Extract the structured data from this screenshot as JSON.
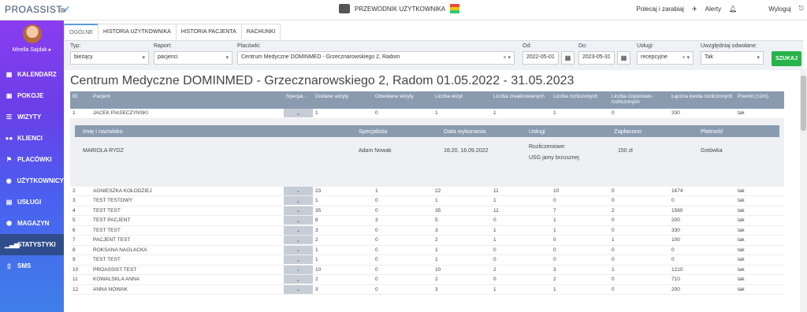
{
  "app": {
    "logo": "PROASSIST",
    "guide": "PRZEWODNIK UŻYTKOWNIKA",
    "recommend": "Polecaj i zarabiaj",
    "alerts": "Alerty",
    "logout": "Wyloguj"
  },
  "user": {
    "name": "Mirella Sajdak ▸"
  },
  "nav": [
    "KALENDARZ",
    "POKOJE",
    "WIZYTY",
    "KLIENCI",
    "PLACÓWKI",
    "UŻYTKOWNICY",
    "USŁUGI",
    "MAGAZYN",
    "STATYSTYKI",
    "SMS"
  ],
  "tabs": [
    "OGÓLNE",
    "HISTORIA UŻYTKOWNIKA",
    "HISTORIA PACJENTA",
    "RACHUNKI"
  ],
  "filters": {
    "type_label": "Typ:",
    "type_value": "bieżący",
    "report_label": "Raport:",
    "report_value": "pacjenci",
    "places_label": "Placówki:",
    "places_value": "Centrum Medyczne DOMINMED - Grzecznarowskiego 2, Radom",
    "from_label": "Od:",
    "from_value": "2022-05-01",
    "to_label": "Do:",
    "to_value": "2023-05-31",
    "services_label": "Usługi:",
    "services_value": "recepcyjne",
    "cancelled_label": "Uwzględniaj odwołane:",
    "cancelled_value": "Tak",
    "search_button": "SZUKAJ"
  },
  "title": "Centrum Medyczne DOMINMED - Grzecznarowskiego 2, Radom 01.05.2022 - 31.05.2023",
  "columns": [
    "ID",
    "Pacjent",
    "Specjal...",
    "Dodane wizyty",
    "Odwołane wizyty",
    "Liczba wizyt",
    "Liczba zrealizowanych",
    "Liczba rozliczonych",
    "Liczba częściowo-rozliczonych",
    "Łączna kwota rozliczonych",
    "Powrót (12m)"
  ],
  "first_row": [
    "1",
    "JACEK PIASECZYŃSKI",
    "1",
    "0",
    "1",
    "1",
    "1",
    "0",
    "330",
    "tak"
  ],
  "detail": {
    "headers": [
      "Imię i nazwisko",
      "Specjalista",
      "Data wykonania",
      "Usługi",
      "Zapłacono",
      "Płatność"
    ],
    "name": "MARIOLA RYDZ",
    "specialist": "Adam Nowak",
    "date": "16:20, 16.09.2022",
    "service_type": "Rozliczeniowe:",
    "service": "USG jamy brzusznej",
    "paid": "150 zł",
    "payment": "Gotówka"
  },
  "rows": [
    [
      "2",
      "AGNIESZKA KOŁODZIEJ",
      "23",
      "1",
      "22",
      "11",
      "10",
      "0",
      "1674",
      "tak"
    ],
    [
      "3",
      "TEST TESTOWY",
      "1",
      "0",
      "1",
      "1",
      "0",
      "0",
      "0",
      "tak"
    ],
    [
      "4",
      "TEST TEST",
      "35",
      "0",
      "35",
      "11",
      "7",
      "2",
      "1560",
      "tak"
    ],
    [
      "5",
      "TEST PACJENT",
      "8",
      "3",
      "5",
      "0",
      "1",
      "0",
      "200",
      "tak"
    ],
    [
      "6",
      "TEST TEST",
      "3",
      "0",
      "3",
      "1",
      "1",
      "0",
      "330",
      "tak"
    ],
    [
      "7",
      "PACJENT TEST",
      "2",
      "0",
      "2",
      "1",
      "0",
      "1",
      "100",
      "tak"
    ],
    [
      "8",
      "ROKSANA NAGLACKA",
      "1",
      "0",
      "1",
      "0",
      "0",
      "0",
      "0",
      "tak"
    ],
    [
      "9",
      "TEST TEST",
      "1",
      "0",
      "1",
      "0",
      "0",
      "0",
      "0",
      "tak"
    ],
    [
      "10",
      "PROASSIST TEST",
      "10",
      "0",
      "10",
      "2",
      "3",
      "1",
      "1210",
      "tak"
    ],
    [
      "11",
      "KOWALSKLA ANNA",
      "2",
      "0",
      "2",
      "0",
      "2",
      "0",
      "710",
      "tak"
    ],
    [
      "12",
      "ANNA NOWAK",
      "3",
      "0",
      "3",
      "1",
      "1",
      "0",
      "200",
      "tak"
    ]
  ]
}
